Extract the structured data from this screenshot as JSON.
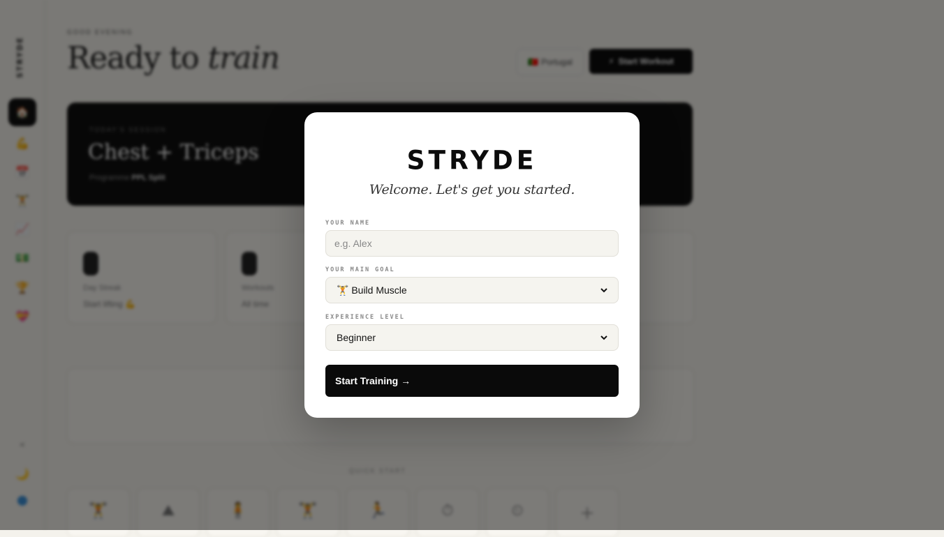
{
  "background": {
    "sidebar": {
      "logo": "STRYDE",
      "nav_icons": [
        "home-icon",
        "flex-icon",
        "calendar-icon",
        "dumbbell-icon",
        "chart-icon",
        "money-icon",
        "trophy-icon",
        "heart-icon"
      ],
      "bottom_icons": [
        "chevron-icon",
        "moon-icon",
        "globe-icon"
      ]
    },
    "header": {
      "eyebrow": "GOOD EVENING",
      "title_plain": "Ready to",
      "title_italic": "train",
      "ghost_button": "Portugal",
      "primary_button": "Start Workout",
      "primary_button_icon": "⚡",
      "ghost_button_icon": "🇵🇹"
    },
    "workout_card": {
      "eyebrow": "TODAY'S SESSION",
      "title": "Chest + Triceps",
      "sub_prefix": "Programme",
      "sub_value": "PPL Split"
    },
    "stats": [
      {
        "label": "Day Streak",
        "value": "Start lifting 💪"
      },
      {
        "label": "Workouts",
        "value": "All time"
      }
    ],
    "bottom_label": "QUICK START",
    "tiles": [
      "dumbbell-icon",
      "mountain-icon",
      "person-icon",
      "squat-icon",
      "run-icon",
      "clock-icon",
      "timer-icon",
      "plus-icon"
    ]
  },
  "modal": {
    "brand": "STRYDE",
    "welcome": "Welcome. Let's get you started.",
    "name_label": "YOUR NAME",
    "name_placeholder": "e.g. Alex",
    "name_value": "",
    "goal_label": "YOUR MAIN GOAL",
    "goal_value": "🏋️ Build Muscle",
    "level_label": "EXPERIENCE LEVEL",
    "level_value": "Beginner",
    "cta_label": "Start Training →"
  },
  "colors": {
    "overlay": "rgba(0,0,0,0.5)",
    "cta_bg": "#0a0a0a",
    "field_bg": "#f5f4ef"
  }
}
